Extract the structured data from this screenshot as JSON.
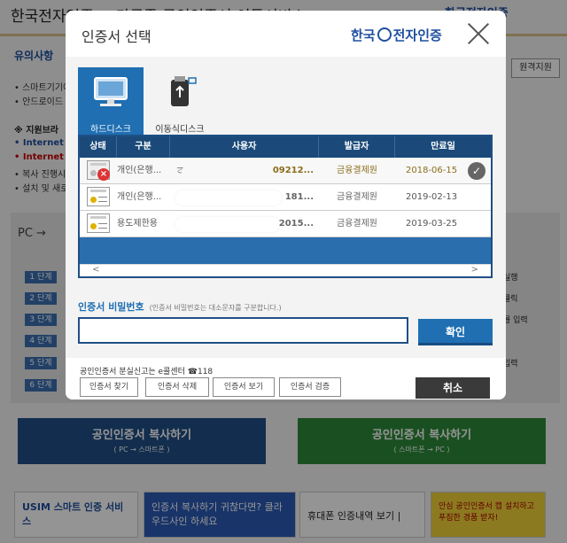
{
  "background": {
    "title": "한국전자인증 > 다국종 공인인증서 이동서비스",
    "logo": "한국전자인증",
    "section_title": "유의사항",
    "remote_button": "원격지원",
    "bullets": [
      "• 스마트기기에",
      "• 안드로이드"
    ],
    "support_heading": "※ 지원브라",
    "bold_items": [
      "• Internet E",
      "• Internet E"
    ],
    "more_bullets": [
      "• 복사 진행시",
      "• 설치 및 새로"
    ],
    "pc_label": "PC →",
    "steps": [
      "1 단계",
      "2 단계",
      "3 단계",
      "4 단계",
      "5 단계",
      "6 단계"
    ],
    "right_texts": [
      "실행",
      "클릭",
      "를 입력",
      "입력"
    ],
    "copy_pc": {
      "label": "공인인증서 복사하기",
      "sub": "( PC → 스마트폰 )"
    },
    "copy_phone": {
      "label": "공인인증서 복사하기",
      "sub": "( 스마트폰 → PC )"
    },
    "banners": {
      "usim": "USIM 스마트 인증 서비스",
      "cloud": "인증서 복사하기 귀찮다면? 클라우드사인 하세요",
      "phone": "휴대폰 인증내역 보기 |",
      "ad": "안심 공인인증서 캡 설치하고 푸짐한 경품 받자!"
    }
  },
  "dialog": {
    "title": "인증서 선택",
    "brand": {
      "left": "한국",
      "right": "전자인증"
    },
    "media_tabs": [
      {
        "label": "하드디스크",
        "active": true
      },
      {
        "label": "이동식디스크",
        "active": false
      }
    ],
    "table": {
      "headers": [
        "상태",
        "구분",
        "사용자",
        "발급자",
        "만료일"
      ],
      "rows": [
        {
          "type": "개인(은행...",
          "user_prefix": "ਟ",
          "user_suffix": "09212...",
          "issuer": "금융결제원",
          "expiry": "2018-06-15",
          "expired": true,
          "selected": true
        },
        {
          "type": "개인(은행...",
          "user_prefix": "",
          "user_suffix": "181...",
          "issuer": "금융결제원",
          "expiry": "2019-02-13",
          "expired": false,
          "selected": false
        },
        {
          "type": "용도제한용",
          "user_prefix": "",
          "user_suffix": "2015...",
          "issuer": "금융결제원",
          "expiry": "2019-03-25",
          "expired": false,
          "selected": false
        }
      ],
      "scroll_left": "<",
      "scroll_right": ">"
    },
    "password": {
      "label": "인증서 비밀번호",
      "hint": "(인증서 비밀번호는 대소문자를 구분합니다.)",
      "value": ""
    },
    "ok_button": "확인",
    "help_text": "공인인증서 분실신고는 e콜센터 ☎118",
    "small_buttons": [
      "인증서 찾기",
      "인증서 삭제",
      "인증서 보기",
      "인증서 검증"
    ],
    "cancel_button": "취소",
    "icons": [
      "harddisk-icon",
      "usb-drive-icon",
      "certificate-icon",
      "expired-icon",
      "check-icon",
      "close-icon"
    ]
  }
}
